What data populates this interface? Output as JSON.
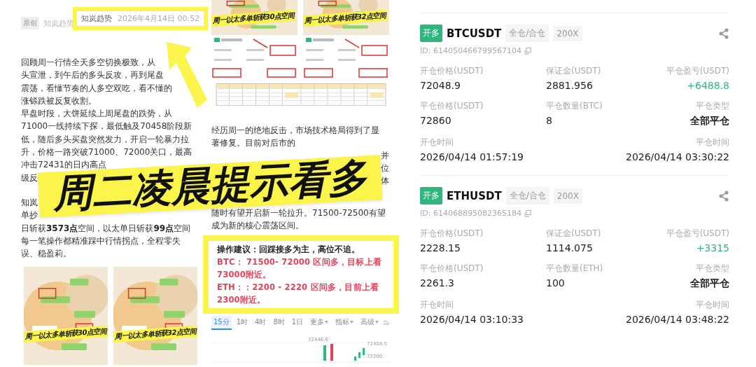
{
  "left": {
    "source_badge": "原创",
    "author": "知岚趋势",
    "highlight": {
      "author": "知岚趋势",
      "date": "2026年4月14日 00:52"
    },
    "paragraphs": [
      [
        "回顾周一行情全天多空切换极致，从",
        "头宣泄，到午后的多头反攻，再到尾盘",
        "震荡，看懂节奏的人多空双吃，看不懂的",
        "涨铩跌被反复收割。"
      ],
      [
        "早盘时段，大饼延续上周尾盘的跌势，从",
        "71000一线持续下探，最低触及70458阶段新",
        "低，随后多头买盘突然发力，开启一轮暴力拉",
        "升，价格一路突破71000、72000关口，最高",
        "冲击72431的日内高点",
        "级反"
      ],
      [
        "知岚",
        "单抄",
        "日斩获**3573点**空间，以太单日斩获**99点**空间",
        "每一笔操作都精准踩中行情拐点，全程零失",
        "误、稳盈莉。"
      ]
    ],
    "thumbnails": [
      {
        "kind": "picture",
        "caption": "周一以太多单斩获30点空间"
      },
      {
        "kind": "picture",
        "caption": "周一以太多单斩获32点空间"
      }
    ]
  },
  "middle": {
    "thumbnails": [
      {
        "kind": "picture",
        "caption": "周一以太多单斩获30点空间"
      },
      {
        "kind": "picture",
        "caption": "周一以太多单斩获32点空间"
      }
    ],
    "lines": [
      "经历周一的绝地反击，市场技术格局得到了显",
      "著修复。目前对后市的"
    ],
    "fragments": [
      "并",
      "位",
      "体"
    ],
    "lines_after": [
      "随时有望开启新一轮拉升。71500-72500有望",
      "成为新的核心震荡区间。"
    ],
    "advice": {
      "title": "操作建议：回踩接多为主，高位不追。",
      "lines": [
        "BTC： 71500- 72000 区间多，目标上看",
        "73000附近。",
        "ETH：：2200 - 2220 区间多，目前上看",
        "2300附近。"
      ]
    },
    "chart": {
      "tabs": [
        {
          "label": "15分",
          "selected": true,
          "kind": "plain"
        },
        {
          "label": "1时",
          "selected": false,
          "kind": "plain"
        },
        {
          "label": "4时",
          "selected": false,
          "kind": "plain"
        },
        {
          "label": "8时",
          "selected": false,
          "kind": "plain"
        },
        {
          "label": "1日",
          "selected": false,
          "kind": "plain"
        },
        {
          "label": "更多",
          "selected": false,
          "kind": "menu"
        },
        {
          "label": "指标",
          "selected": false,
          "kind": "menu"
        },
        {
          "label": "高级",
          "selected": false,
          "kind": "menu"
        }
      ],
      "price_labels": [
        "72446.6",
        "72404.5",
        "72200"
      ]
    }
  },
  "banner": {
    "text": "周二凌晨提示看多"
  },
  "trades": [
    {
      "side": "开多",
      "symbol": "BTCUSDT",
      "margin_mode": "全仓/合仓",
      "leverage": "200X",
      "id": "ID: 614050466799567104",
      "fields": [
        {
          "label": "开仓价格(USDT)",
          "value": "72048.9",
          "kind": "plain"
        },
        {
          "label": "保证金(USDT)",
          "value": "2881.956",
          "kind": "plain"
        },
        {
          "label": "平仓盈亏(USDT)",
          "value": "+6488.8",
          "kind": "profit"
        },
        {
          "label": "平仓价格(USDT)",
          "value": "72860",
          "kind": "plain"
        },
        {
          "label": "平仓数量(BTC)",
          "value": "8",
          "kind": "plain"
        },
        {
          "label": "平仓类型",
          "value": "全部平仓",
          "kind": "bold"
        },
        {
          "label": "开仓时间",
          "value": "2026/04/14 01:57:19",
          "kind": "plain"
        },
        {
          "label": "平仓时间",
          "value": "2026/04/14 03:30:22",
          "kind": "plain"
        }
      ]
    },
    {
      "side": "开多",
      "symbol": "ETHUSDT",
      "margin_mode": "全仓/合仓",
      "leverage": "200X",
      "id": "ID: 614068895082365184",
      "fields": [
        {
          "label": "开仓价格(USDT)",
          "value": "2228.15",
          "kind": "plain"
        },
        {
          "label": "保证金(USDT)",
          "value": "1114.075",
          "kind": "plain"
        },
        {
          "label": "平仓盈亏(USDT)",
          "value": "+3315",
          "kind": "profit"
        },
        {
          "label": "平仓价格(USDT)",
          "value": "2261.3",
          "kind": "plain"
        },
        {
          "label": "平仓数量(ETH)",
          "value": "100",
          "kind": "plain"
        },
        {
          "label": "平仓类型",
          "value": "全部平仓",
          "kind": "bold"
        },
        {
          "label": "开仓时间",
          "value": "2026/04/14 03:10:33",
          "kind": "plain"
        },
        {
          "label": "平仓时间",
          "value": "2026/04/14 03:48:22",
          "kind": "plain"
        }
      ]
    }
  ]
}
